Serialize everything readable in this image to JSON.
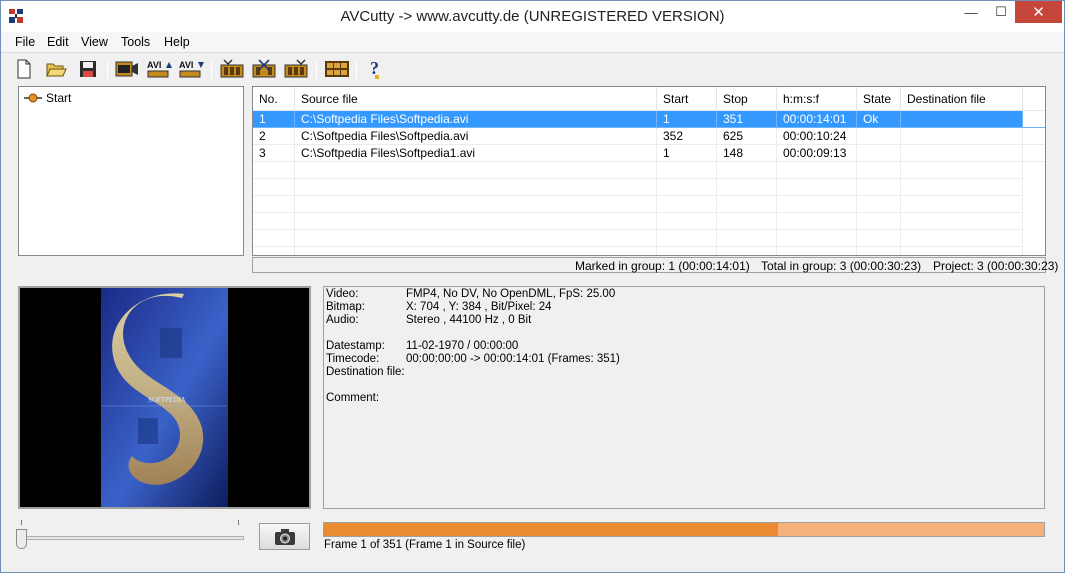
{
  "window": {
    "title": "AVCutty -> www.avcutty.de (UNREGISTERED VERSION)",
    "controls": {
      "minimize": "—",
      "maximize": "☐",
      "close": "✕"
    }
  },
  "menu": [
    "File",
    "Edit",
    "View",
    "Tools",
    "Help"
  ],
  "toolbar": {
    "buttons": [
      {
        "name": "new-file-icon"
      },
      {
        "name": "open-folder-icon"
      },
      {
        "name": "save-icon"
      },
      {
        "name": "capture-video-icon"
      },
      {
        "name": "avi-import-icon",
        "label": "AVI"
      },
      {
        "name": "avi-export-icon",
        "label": "AVI"
      },
      {
        "name": "cut-start-icon"
      },
      {
        "name": "cut-scissors-icon"
      },
      {
        "name": "cut-end-icon"
      },
      {
        "name": "frames-grid-icon"
      },
      {
        "name": "help-icon"
      }
    ]
  },
  "tree": {
    "root": "Start"
  },
  "table": {
    "columns": [
      "No.",
      "Source file",
      "Start",
      "Stop",
      "h:m:s:f",
      "State",
      "Destination file"
    ],
    "rows": [
      {
        "no": "1",
        "source": "C:\\Softpedia Files\\Softpedia.avi",
        "start": "1",
        "stop": "351",
        "hms": "00:00:14:01",
        "state": "Ok",
        "dest": "",
        "selected": true
      },
      {
        "no": "2",
        "source": "C:\\Softpedia Files\\Softpedia.avi",
        "start": "352",
        "stop": "625",
        "hms": "00:00:10:24",
        "state": "",
        "dest": ""
      },
      {
        "no": "3",
        "source": "C:\\Softpedia Files\\Softpedia1.avi",
        "start": "1",
        "stop": "148",
        "hms": "00:00:09:13",
        "state": "",
        "dest": ""
      }
    ]
  },
  "group_status": {
    "marked": "Marked in group: 1 (00:00:14:01)",
    "total": "Total in group: 3 (00:00:30:23)",
    "project": "Project: 3 (00:00:30:23)"
  },
  "info": {
    "video_label": "Video:",
    "video": "FMP4, No DV, No OpenDML, FpS: 25.00",
    "bitmap_label": "Bitmap:",
    "bitmap": "X: 704 , Y: 384 , Bit/Pixel: 24",
    "audio_label": "Audio:",
    "audio": "Stereo , 44100 Hz , 0 Bit",
    "datestamp_label": "Datestamp:",
    "datestamp": "11-02-1970 / 00:00:00",
    "timecode_label": "Timecode:",
    "timecode": "00:00:00:00 -> 00:00:14:01 (Frames: 351)",
    "destination_label": "Destination file:",
    "destination": "",
    "comment_label": "Comment:",
    "comment": ""
  },
  "progress": {
    "fraction": 0.63,
    "label": "Frame 1 of 351 (Frame 1 in Source file)"
  },
  "preview": {
    "watermark": "SOFTPEDIA"
  },
  "colors": {
    "selection": "#3399ff",
    "progress_fill": "#ea8a33",
    "progress_bg": "#f4b27a",
    "close_button": "#c7463c"
  }
}
